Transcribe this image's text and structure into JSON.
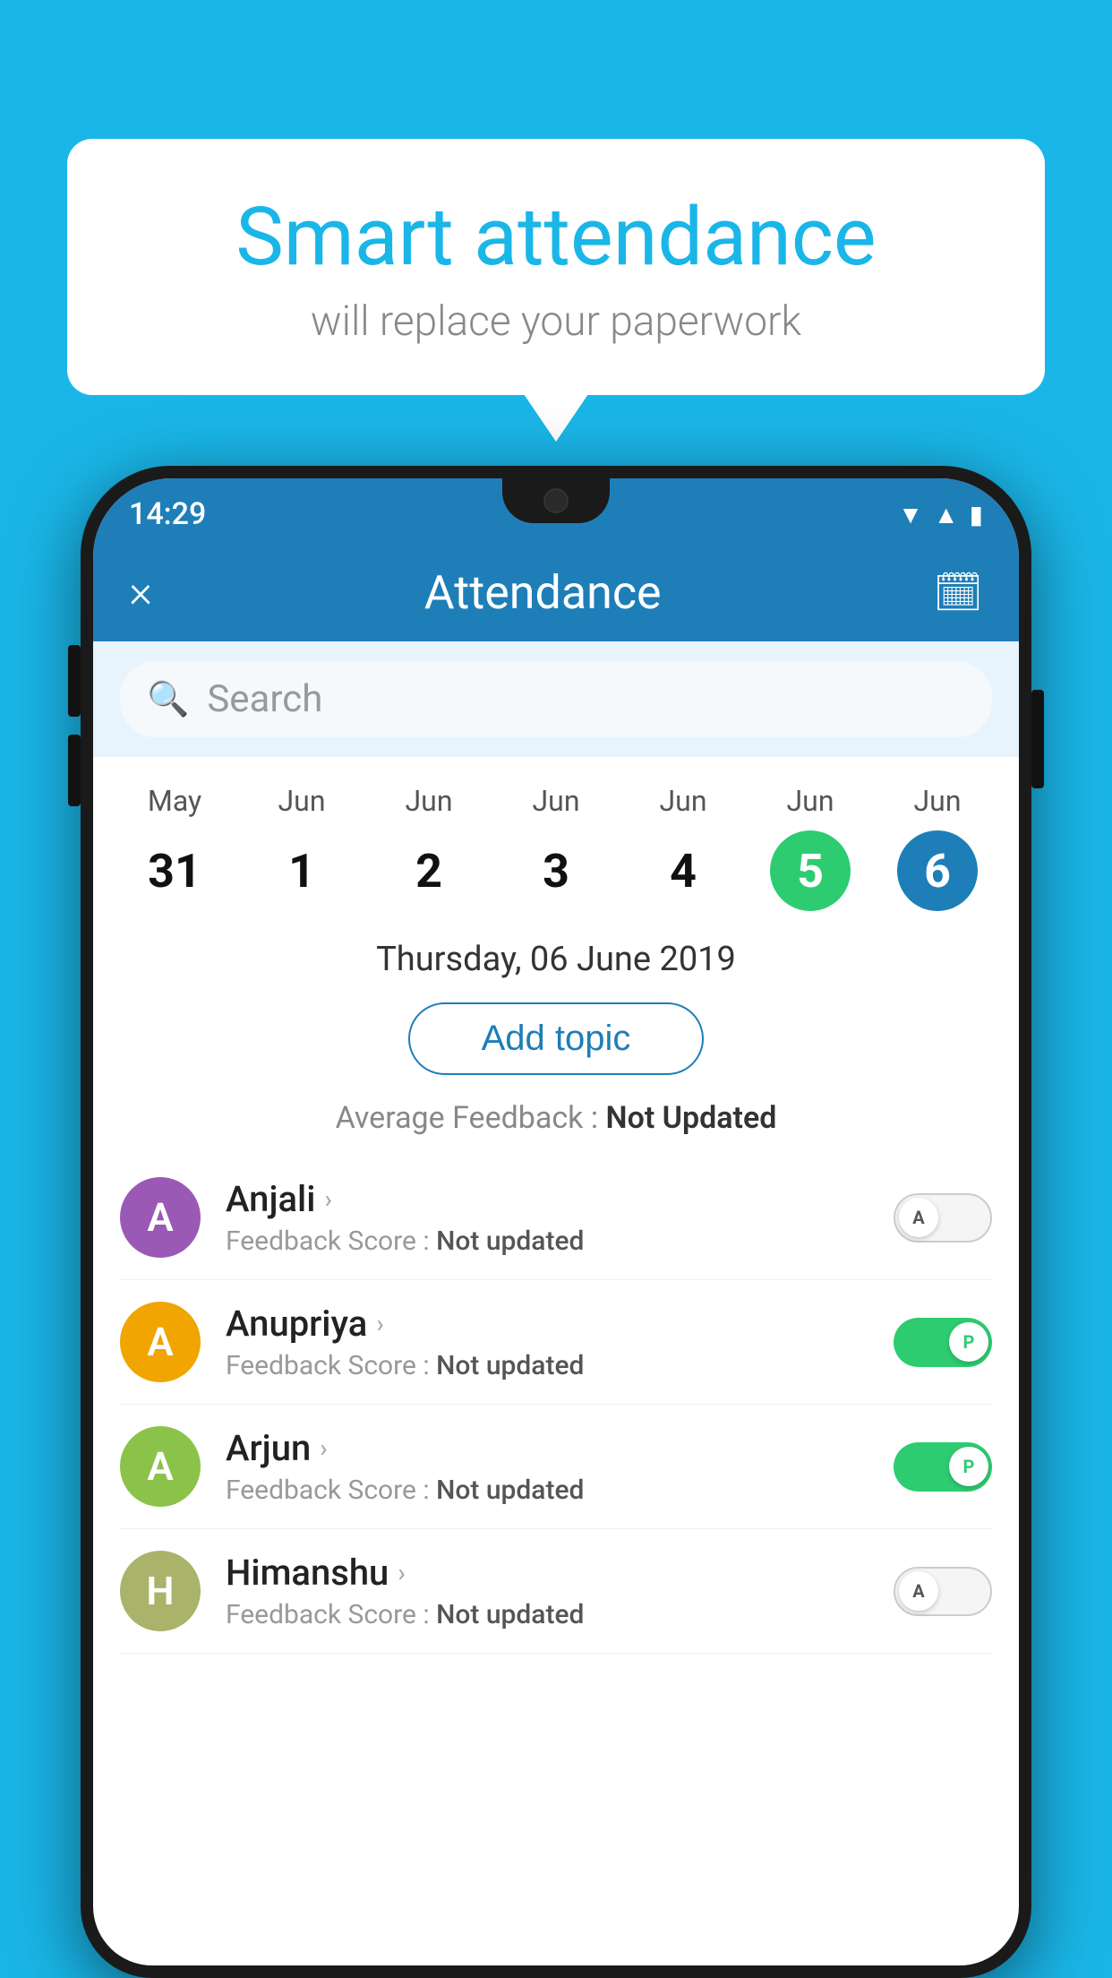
{
  "background_color": "#1ab6e8",
  "speech_bubble": {
    "title": "Smart attendance",
    "subtitle": "will replace your paperwork"
  },
  "phone": {
    "status_bar": {
      "time": "14:29"
    },
    "header": {
      "close_label": "×",
      "title": "Attendance",
      "calendar_icon": "calendar"
    },
    "search": {
      "placeholder": "Search"
    },
    "calendar": {
      "days": [
        {
          "month": "May",
          "num": "31",
          "state": "normal"
        },
        {
          "month": "Jun",
          "num": "1",
          "state": "normal"
        },
        {
          "month": "Jun",
          "num": "2",
          "state": "normal"
        },
        {
          "month": "Jun",
          "num": "3",
          "state": "normal"
        },
        {
          "month": "Jun",
          "num": "4",
          "state": "normal"
        },
        {
          "month": "Jun",
          "num": "5",
          "state": "today"
        },
        {
          "month": "Jun",
          "num": "6",
          "state": "selected"
        }
      ],
      "selected_date": "Thursday, 06 June 2019"
    },
    "add_topic_button": "Add topic",
    "avg_feedback_label": "Average Feedback :",
    "avg_feedback_value": "Not Updated",
    "students": [
      {
        "name": "Anjali",
        "avatar_letter": "A",
        "avatar_color": "#9b59b6",
        "feedback_label": "Feedback Score :",
        "feedback_value": "Not updated",
        "toggle": "off",
        "toggle_letter": "A"
      },
      {
        "name": "Anupriya",
        "avatar_letter": "A",
        "avatar_color": "#f0a500",
        "feedback_label": "Feedback Score :",
        "feedback_value": "Not updated",
        "toggle": "on",
        "toggle_letter": "P"
      },
      {
        "name": "Arjun",
        "avatar_letter": "A",
        "avatar_color": "#8bc34a",
        "feedback_label": "Feedback Score :",
        "feedback_value": "Not updated",
        "toggle": "on",
        "toggle_letter": "P"
      },
      {
        "name": "Himanshu",
        "avatar_letter": "H",
        "avatar_color": "#aab36a",
        "feedback_label": "Feedback Score :",
        "feedback_value": "Not updated",
        "toggle": "off",
        "toggle_letter": "A"
      }
    ]
  }
}
